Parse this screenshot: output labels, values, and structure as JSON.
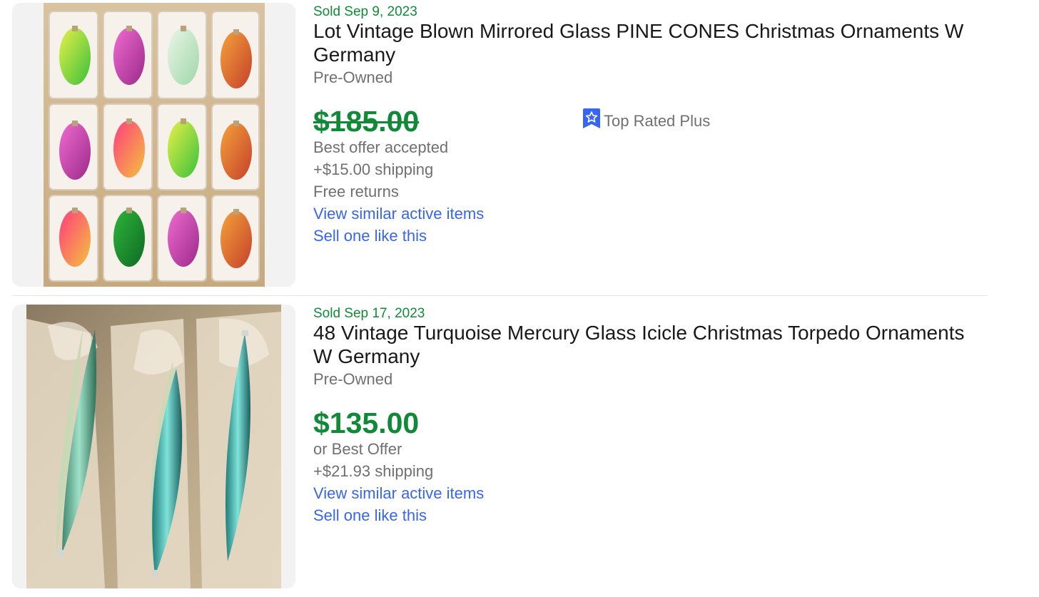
{
  "listings": [
    {
      "sold_date": "Sold Sep 9, 2023",
      "title": "Lot Vintage Blown Mirrored Glass PINE CONES Christmas Ornaments W Germany",
      "condition": "Pre-Owned",
      "price": "$185.00",
      "price_struck": true,
      "offer_status": "Best offer accepted",
      "shipping": "+$15.00 shipping",
      "returns": "Free returns",
      "badge": "Top Rated Plus",
      "view_similar": "View similar active items",
      "sell_one": "Sell one like this"
    },
    {
      "sold_date": "Sold Sep 17, 2023",
      "title": "48 Vintage Turquoise Mercury Glass Icicle Christmas Torpedo Ornaments W Germany",
      "condition": "Pre-Owned",
      "price": "$135.00",
      "price_struck": false,
      "offer_status": "or Best Offer",
      "shipping": "+$21.93 shipping",
      "view_similar": "View similar active items",
      "sell_one": "Sell one like this"
    }
  ],
  "colors": {
    "sold_green": "#118a38",
    "link_blue": "#3665f3",
    "secondary_text": "#707070",
    "badge_blue": "#3665f3"
  },
  "icons": {
    "badge_icon": "top-rated-ribbon-star"
  }
}
